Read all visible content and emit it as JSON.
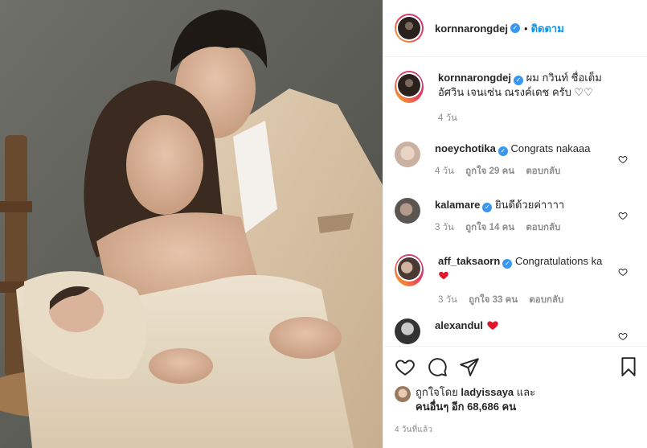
{
  "post": {
    "username": "kornnarongdej",
    "follow_label": "ติดตาม",
    "caption_user": "kornnarongdej",
    "caption_text": "ผม กวินท์ ชื่อเต็ม อัศวิน เจนเซ่น ณรงค์เดช ครับ ♡♡",
    "caption_time": "4 วัน"
  },
  "comments": [
    {
      "user": "noeychotika",
      "text": "Congrats nakaaa",
      "time": "4 วัน",
      "likes": "ถูกใจ 29 คน",
      "reply": "ตอบกลับ"
    },
    {
      "user": "kalamare",
      "text": "ยินดีด้วยค่าาาา",
      "time": "3 วัน",
      "likes": "ถูกใจ 14 คน",
      "reply": "ตอบกลับ"
    },
    {
      "user": "aff_taksaorn",
      "text": "Congratulations ka",
      "time": "3 วัน",
      "likes": "ถูกใจ 33 คน",
      "reply": "ตอบกลับ"
    },
    {
      "user": "alexandul",
      "text": ""
    }
  ],
  "likes": {
    "prefix": "ถูกใจโดย",
    "user": "ladyissaya",
    "and": "และ",
    "others": "คนอื่นๆ อีก 68,686 คน"
  },
  "timestamp": "4 วันที่แล้ว",
  "icons": [
    "verified-badge-icon",
    "heart-icon",
    "comment-icon",
    "share-icon",
    "bookmark-icon"
  ],
  "colors": {
    "accent": "#0095f6",
    "verified": "#3897f0",
    "like_red": "#ed4956",
    "muted": "#8e8e8e"
  }
}
